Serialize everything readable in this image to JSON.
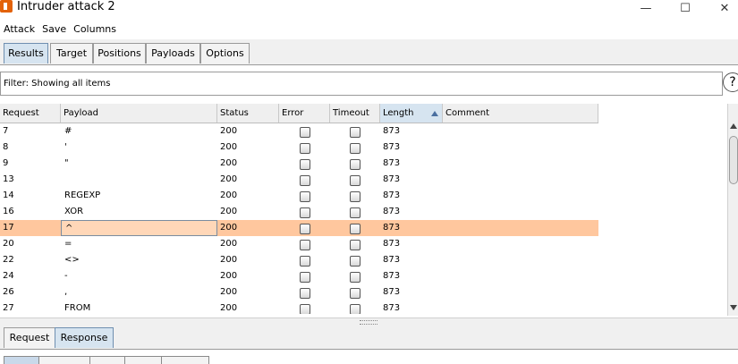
{
  "window": {
    "title": "Intruder attack 2"
  },
  "menu": [
    "Attack",
    "Save",
    "Columns"
  ],
  "tabs": [
    "Results",
    "Target",
    "Positions",
    "Payloads",
    "Options"
  ],
  "filter": {
    "text": "Filter: Showing all items"
  },
  "help_glyph": "?",
  "table": {
    "columns": [
      "Request",
      "Payload",
      "Status",
      "Error",
      "Timeout",
      "Length",
      "Comment"
    ],
    "sorted_column": "Length",
    "selected_request": "17",
    "rows": [
      {
        "request": "7",
        "payload": "#",
        "status": "200",
        "length": "873"
      },
      {
        "request": "8",
        "payload": "'",
        "status": "200",
        "length": "873"
      },
      {
        "request": "9",
        "payload": "\"",
        "status": "200",
        "length": "873"
      },
      {
        "request": "13",
        "payload": "",
        "status": "200",
        "length": "873"
      },
      {
        "request": "14",
        "payload": "REGEXP",
        "status": "200",
        "length": "873"
      },
      {
        "request": "16",
        "payload": "XOR",
        "status": "200",
        "length": "873"
      },
      {
        "request": "17",
        "payload": "^",
        "status": "200",
        "length": "873"
      },
      {
        "request": "20",
        "payload": "=",
        "status": "200",
        "length": "873"
      },
      {
        "request": "22",
        "payload": "<>",
        "status": "200",
        "length": "873"
      },
      {
        "request": "24",
        "payload": "-",
        "status": "200",
        "length": "873"
      },
      {
        "request": "26",
        "payload": ",",
        "status": "200",
        "length": "873"
      },
      {
        "request": "27",
        "payload": "FROM",
        "status": "200",
        "length": "873"
      }
    ]
  },
  "bottom_tabs": [
    "Request",
    "Response"
  ],
  "colors": {
    "selected_row": "#ffc79e",
    "active_tab": "#d6e4f0",
    "app_icon": "#e36209"
  }
}
